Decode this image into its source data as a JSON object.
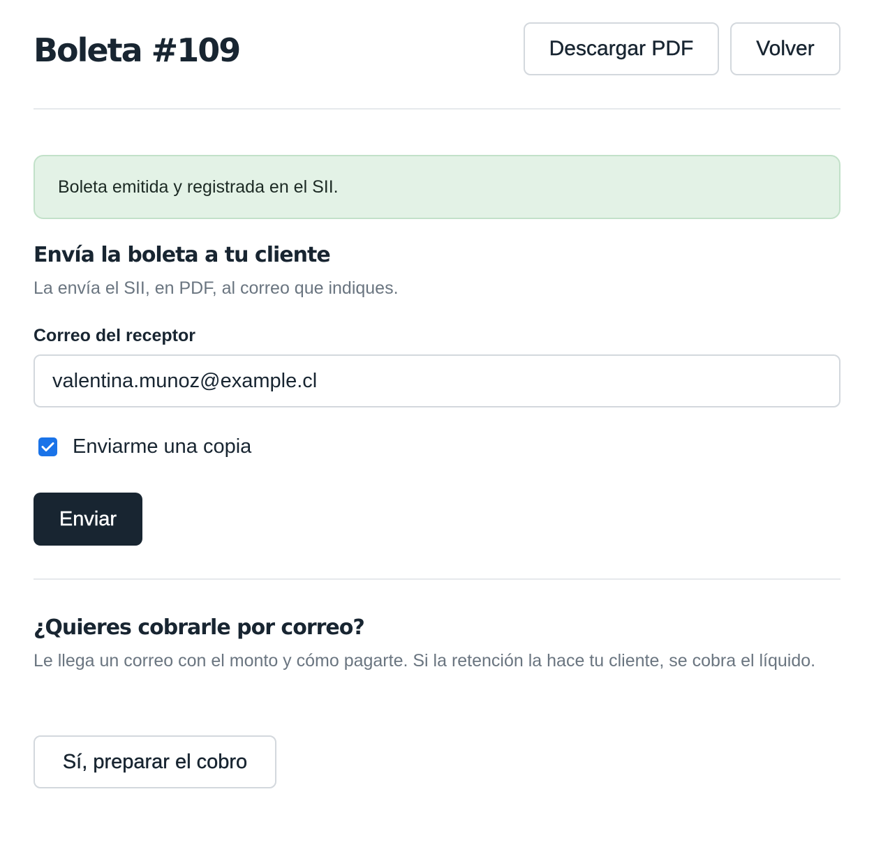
{
  "header": {
    "title": "Boleta #109",
    "download_label": "Descargar PDF",
    "back_label": "Volver"
  },
  "alert": {
    "message": "Boleta emitida y registrada en el SII.",
    "color": "#e3f2e6"
  },
  "send_section": {
    "heading": "Envía la boleta a tu cliente",
    "subtext": "La envía el SII, en PDF, al correo que indiques.",
    "email_label": "Correo del receptor",
    "email_value": "valentina.munoz@example.cl",
    "copy_label": "Enviarme una copia",
    "copy_checked": true,
    "send_label": "Enviar"
  },
  "charge_section": {
    "heading": "¿Quieres cobrarle por correo?",
    "subtext": "Le llega un correo con el monto y cómo pagarte. Si la retención la hace tu cliente, se cobra el líquido.",
    "button_label": "Sí, preparar el cobro"
  },
  "colors": {
    "primary": "#182531",
    "checkbox": "#1a73e8",
    "muted_text": "#6a7580"
  }
}
